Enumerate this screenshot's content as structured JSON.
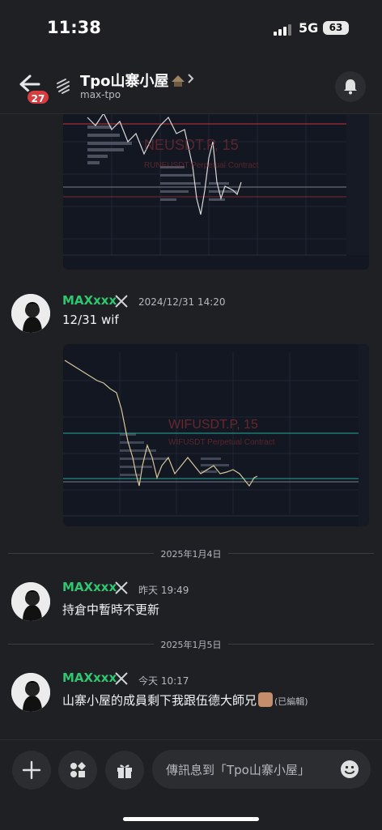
{
  "status_bar": {
    "time": "11:38",
    "network": "5G",
    "battery": "63"
  },
  "header": {
    "unread_badge": "27",
    "title": "Tpo山寨小屋",
    "subtitle": "max-tpo"
  },
  "charts": [
    {
      "watermark_symbol": "NEUSDT.P, 15",
      "watermark_name": "RUNEUSDT Perpetual Contract"
    },
    {
      "watermark_symbol": "WIFUSDT.P, 15",
      "watermark_name": "WIFUSDT Perpetual Contract"
    }
  ],
  "messages": [
    {
      "author": "MAXxxx",
      "timestamp": "2024/12/31 14:20",
      "text": "12/31 wif"
    },
    {
      "author": "MAXxxx",
      "timestamp": "昨天 19:49",
      "text": "持倉中暫時不更新"
    },
    {
      "author": "MAXxxx",
      "timestamp": "今天 10:17",
      "text": "山寨小屋的成員剩下我跟伍德大師兄",
      "edited": "(已編輯)"
    }
  ],
  "day_dividers": [
    "2025年1月4日",
    "2025年1月5日"
  ],
  "composer": {
    "placeholder": "傳訊息到「Tpo山寨小屋」"
  },
  "colors": {
    "author": "#2dc770",
    "badge": "#d83c3e",
    "background": "#1f2024"
  }
}
